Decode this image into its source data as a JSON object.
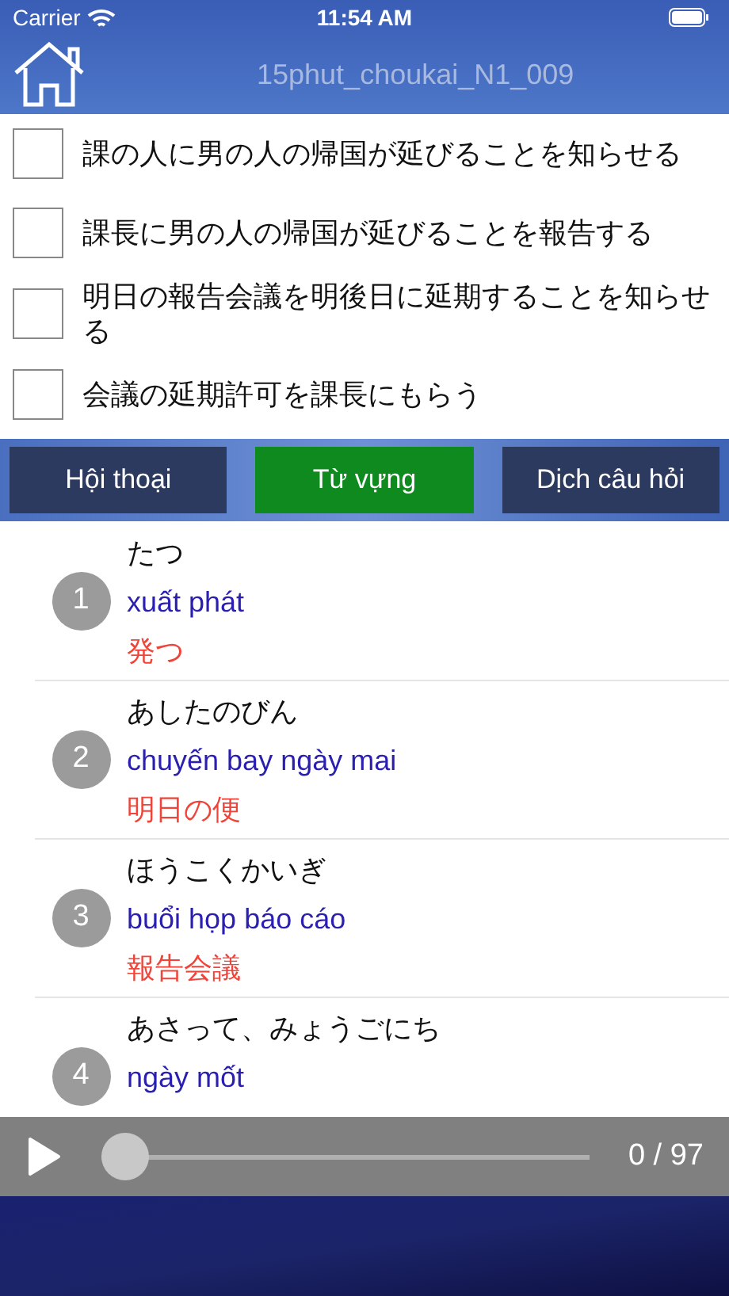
{
  "status_bar": {
    "carrier": "Carrier",
    "time": "11:54 AM"
  },
  "header": {
    "title": "15phut_choukai_N1_009"
  },
  "options": [
    {
      "text": "課の人に男の人の帰国が延びることを知らせる",
      "checked": false
    },
    {
      "text": "課長に男の人の帰国が延びることを報告する",
      "checked": false
    },
    {
      "text": "明日の報告会議を明後日に延期することを知らせる",
      "checked": false
    },
    {
      "text": "会議の延期許可を課長にもらう",
      "checked": false
    }
  ],
  "tabs": [
    {
      "label": "Hội thoại",
      "selected": false
    },
    {
      "label": "Từ vựng",
      "selected": true
    },
    {
      "label": "Dịch câu hỏi",
      "selected": false
    }
  ],
  "vocabulary": [
    {
      "number": "1",
      "reading": "たつ",
      "meaning": "xuất phát",
      "kanji": "発つ"
    },
    {
      "number": "2",
      "reading": "あしたのびん",
      "meaning": "chuyến bay ngày mai",
      "kanji": "明日の便"
    },
    {
      "number": "3",
      "reading": "ほうこくかいぎ",
      "meaning": "buổi họp báo cáo",
      "kanji": "報告会議"
    },
    {
      "number": "4",
      "reading": "あさって、みょうごにち",
      "meaning": "ngày mốt"
    }
  ],
  "player": {
    "level": 0,
    "time": "0 / 97"
  }
}
